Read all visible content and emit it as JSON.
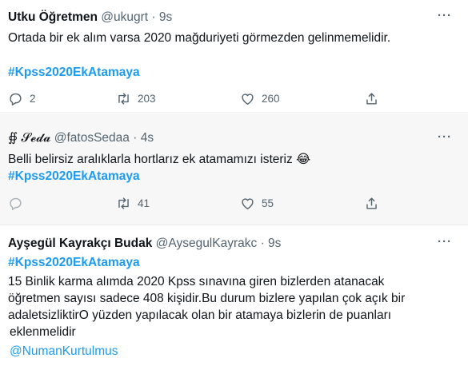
{
  "tweets": [
    {
      "name": "Utku Öğretmen",
      "handle": "@ukugrt",
      "dot": "·",
      "time": "9s",
      "more": "···",
      "text": "Ortada bir ek alım varsa 2020 mağduriyeti görmezden gelinmemelidir.",
      "hashtag": "#Kpss2020EkAtamaya",
      "replies": "2",
      "retweets": "203",
      "likes": "260"
    },
    {
      "name": "∯ 𝓢𝓮𝓭𝓪",
      "handle": "@fatosSedaa",
      "dot": "·",
      "time": "4s",
      "more": "···",
      "text": "Belli belirsiz aralıklarla hortlarız ek atamamızı isteriz 😂",
      "hashtag": "#Kpss2020EkAtamaya",
      "replies": "",
      "retweets": "41",
      "likes": "55"
    },
    {
      "name": "Ayşegül Kayrakçı Budak",
      "handle": "@AysegulKayrakc",
      "dot": "·",
      "time": "9s",
      "more": "···",
      "hashtag": "#Kpss2020EkAtamaya",
      "lines": [
        "15 Binlik karma alımda 2020 Kpss sınavına giren bizlerden atanacak",
        "öğretmen sayısı sadece 408 kişidir.Bu durum bizlere yapılan çok açık bir",
        "adaletsizliktirO yüzden yapılacak olan bir atamaya bizlerin de puanları",
        "eklenmelidir"
      ],
      "mention": "@NumanKurtulmus"
    }
  ],
  "icons": [
    "reply-icon",
    "retweet-icon",
    "like-icon",
    "share-icon",
    "more-icon"
  ],
  "colors": {
    "link": "#1d9bf0",
    "muted": "#536471",
    "text": "#0f1419"
  }
}
